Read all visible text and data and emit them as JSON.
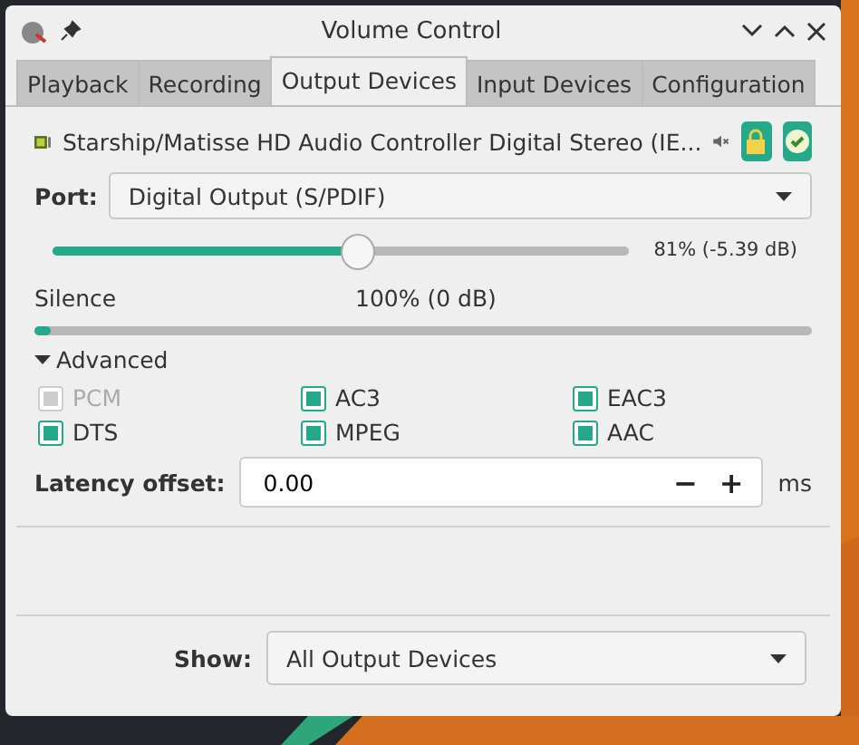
{
  "window": {
    "title": "Volume Control"
  },
  "tabs": [
    {
      "label": "Playback",
      "selected": false
    },
    {
      "label": "Recording",
      "selected": false
    },
    {
      "label": "Output Devices",
      "selected": true
    },
    {
      "label": "Input Devices",
      "selected": false
    },
    {
      "label": "Configuration",
      "selected": false
    }
  ],
  "device": {
    "name": "Starship/Matisse HD Audio Controller Digital Stereo (IE...",
    "muted": true,
    "locked": true,
    "default": true,
    "port_label": "Port:",
    "port": "Digital Output (S/PDIF)",
    "volume": {
      "level": 0.53,
      "reading": "81% (-5.39 dB)"
    },
    "scale_labels": [
      "Silence",
      "100% (0 dB)"
    ],
    "meter": {
      "level": 0.02
    },
    "advanced": {
      "label": "Advanced",
      "expanded": true,
      "formats": [
        {
          "label": "PCM",
          "checked": true,
          "disabled": true
        },
        {
          "label": "AC3",
          "checked": true,
          "disabled": false
        },
        {
          "label": "EAC3",
          "checked": true,
          "disabled": false
        },
        {
          "label": "DTS",
          "checked": true,
          "disabled": false
        },
        {
          "label": "MPEG",
          "checked": true,
          "disabled": false
        },
        {
          "label": "AAC",
          "checked": true,
          "disabled": false
        }
      ]
    },
    "latency": {
      "label": "Latency offset:",
      "value": "0.00",
      "minus": "−",
      "plus": "+",
      "unit": "ms"
    }
  },
  "show": {
    "label": "Show:",
    "value": "All Output Devices"
  }
}
